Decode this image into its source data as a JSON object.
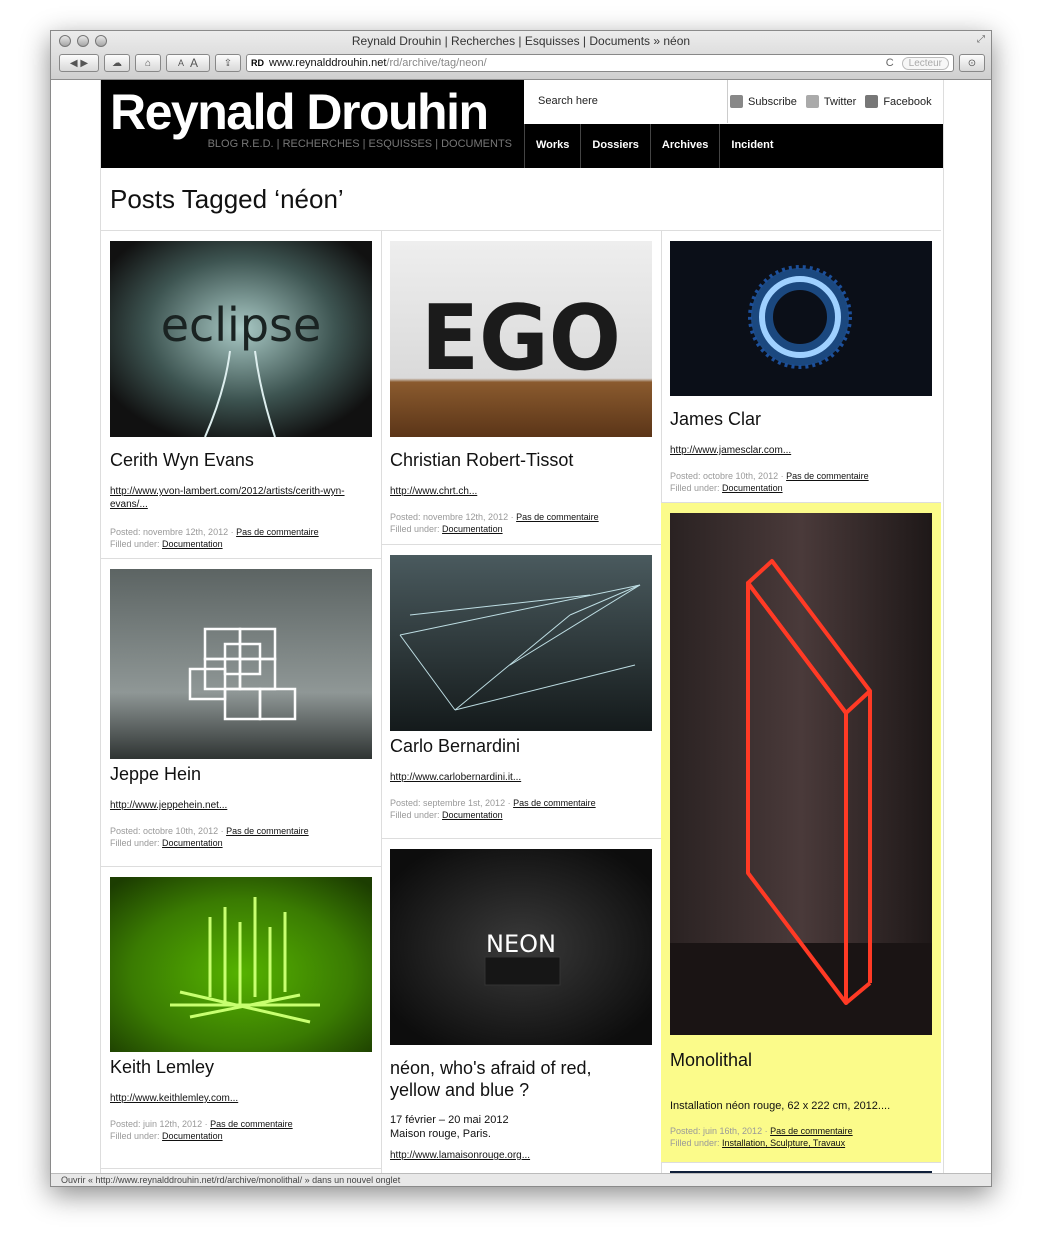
{
  "window": {
    "title": "Reynald Drouhin | Recherches | Esquisses | Documents » néon"
  },
  "toolbar": {
    "font_small": "A",
    "font_large": "A",
    "url_fav": "RD",
    "url_domain": "www.reynalddrouhin.net",
    "url_path": "/rd/archive/tag/neon/",
    "reload": "C",
    "reader": "Lecteur"
  },
  "site": {
    "logo": "Reynald Drouhin",
    "tagline": "BLOG R.E.D. | RECHERCHES | ESQUISSES | DOCUMENTS",
    "search_placeholder": "Search here"
  },
  "social": {
    "subscribe": "Subscribe",
    "twitter": "Twitter",
    "facebook": "Facebook"
  },
  "nav": [
    "Works",
    "Dossiers",
    "Archives",
    "Incident"
  ],
  "page_title": "Posts Tagged ‘néon’",
  "posts": [
    {
      "title": "Cerith Wyn Evans",
      "link": "http://www.yvon-lambert.com/2012/artists/cerith-wyn-evans/...",
      "posted": "Posted: novembre 12th, 2012 ·",
      "comments": "Pas de commentaire",
      "filed": "Filled under:",
      "cats": "Documentation",
      "art": "eclipse"
    },
    {
      "title": "Jeppe Hein",
      "link": "http://www.jeppehein.net...",
      "posted": "Posted: octobre 10th, 2012 ·",
      "comments": "Pas de commentaire",
      "filed": "Filled under:",
      "cats": "Documentation"
    },
    {
      "title": "Keith Lemley",
      "link": "http://www.keithlemley.com...",
      "posted": "Posted: juin 12th, 2012 ·",
      "comments": "Pas de commentaire",
      "filed": "Filled under:",
      "cats": "Documentation"
    },
    {
      "title": "Christian Robert-Tissot",
      "link": "http://www.chrt.ch...",
      "posted": "Posted: novembre 12th, 2012 ·",
      "comments": "Pas de commentaire",
      "filed": "Filled under:",
      "cats": "Documentation",
      "art": "EGO"
    },
    {
      "title": "Carlo Bernardini",
      "link": "http://www.carlobernardini.it...",
      "posted": "Posted: septembre 1st, 2012 ·",
      "comments": "Pas de commentaire",
      "filed": "Filled under:",
      "cats": "Documentation"
    },
    {
      "title": "néon, who's afraid of red, yellow and blue ?",
      "dates": "17 février – 20 mai 2012",
      "place": "Maison rouge, Paris.",
      "link": "http://www.lamaisonrouge.org...",
      "art": "NEON"
    },
    {
      "title": "James Clar",
      "link": "http://www.jamesclar.com...",
      "posted": "Posted: octobre 10th, 2012 ·",
      "comments": "Pas de commentaire",
      "filed": "Filled under:",
      "cats": "Documentation"
    },
    {
      "title": "Monolithal",
      "desc": "Installation néon rouge, 62 x 222 cm, 2012....",
      "posted": "Posted: juin 16th, 2012 ·",
      "comments": "Pas de commentaire",
      "filed": "Filled under:",
      "cats": "Installation, Sculpture, Travaux"
    }
  ],
  "status": "Ouvrir « http://www.reynalddrouhin.net/rd/archive/monolithal/ » dans un nouvel onglet",
  "colors": {
    "highlight": "#fbfb8a",
    "header_bg": "#000000",
    "neon_red": "#ff2a1f"
  }
}
